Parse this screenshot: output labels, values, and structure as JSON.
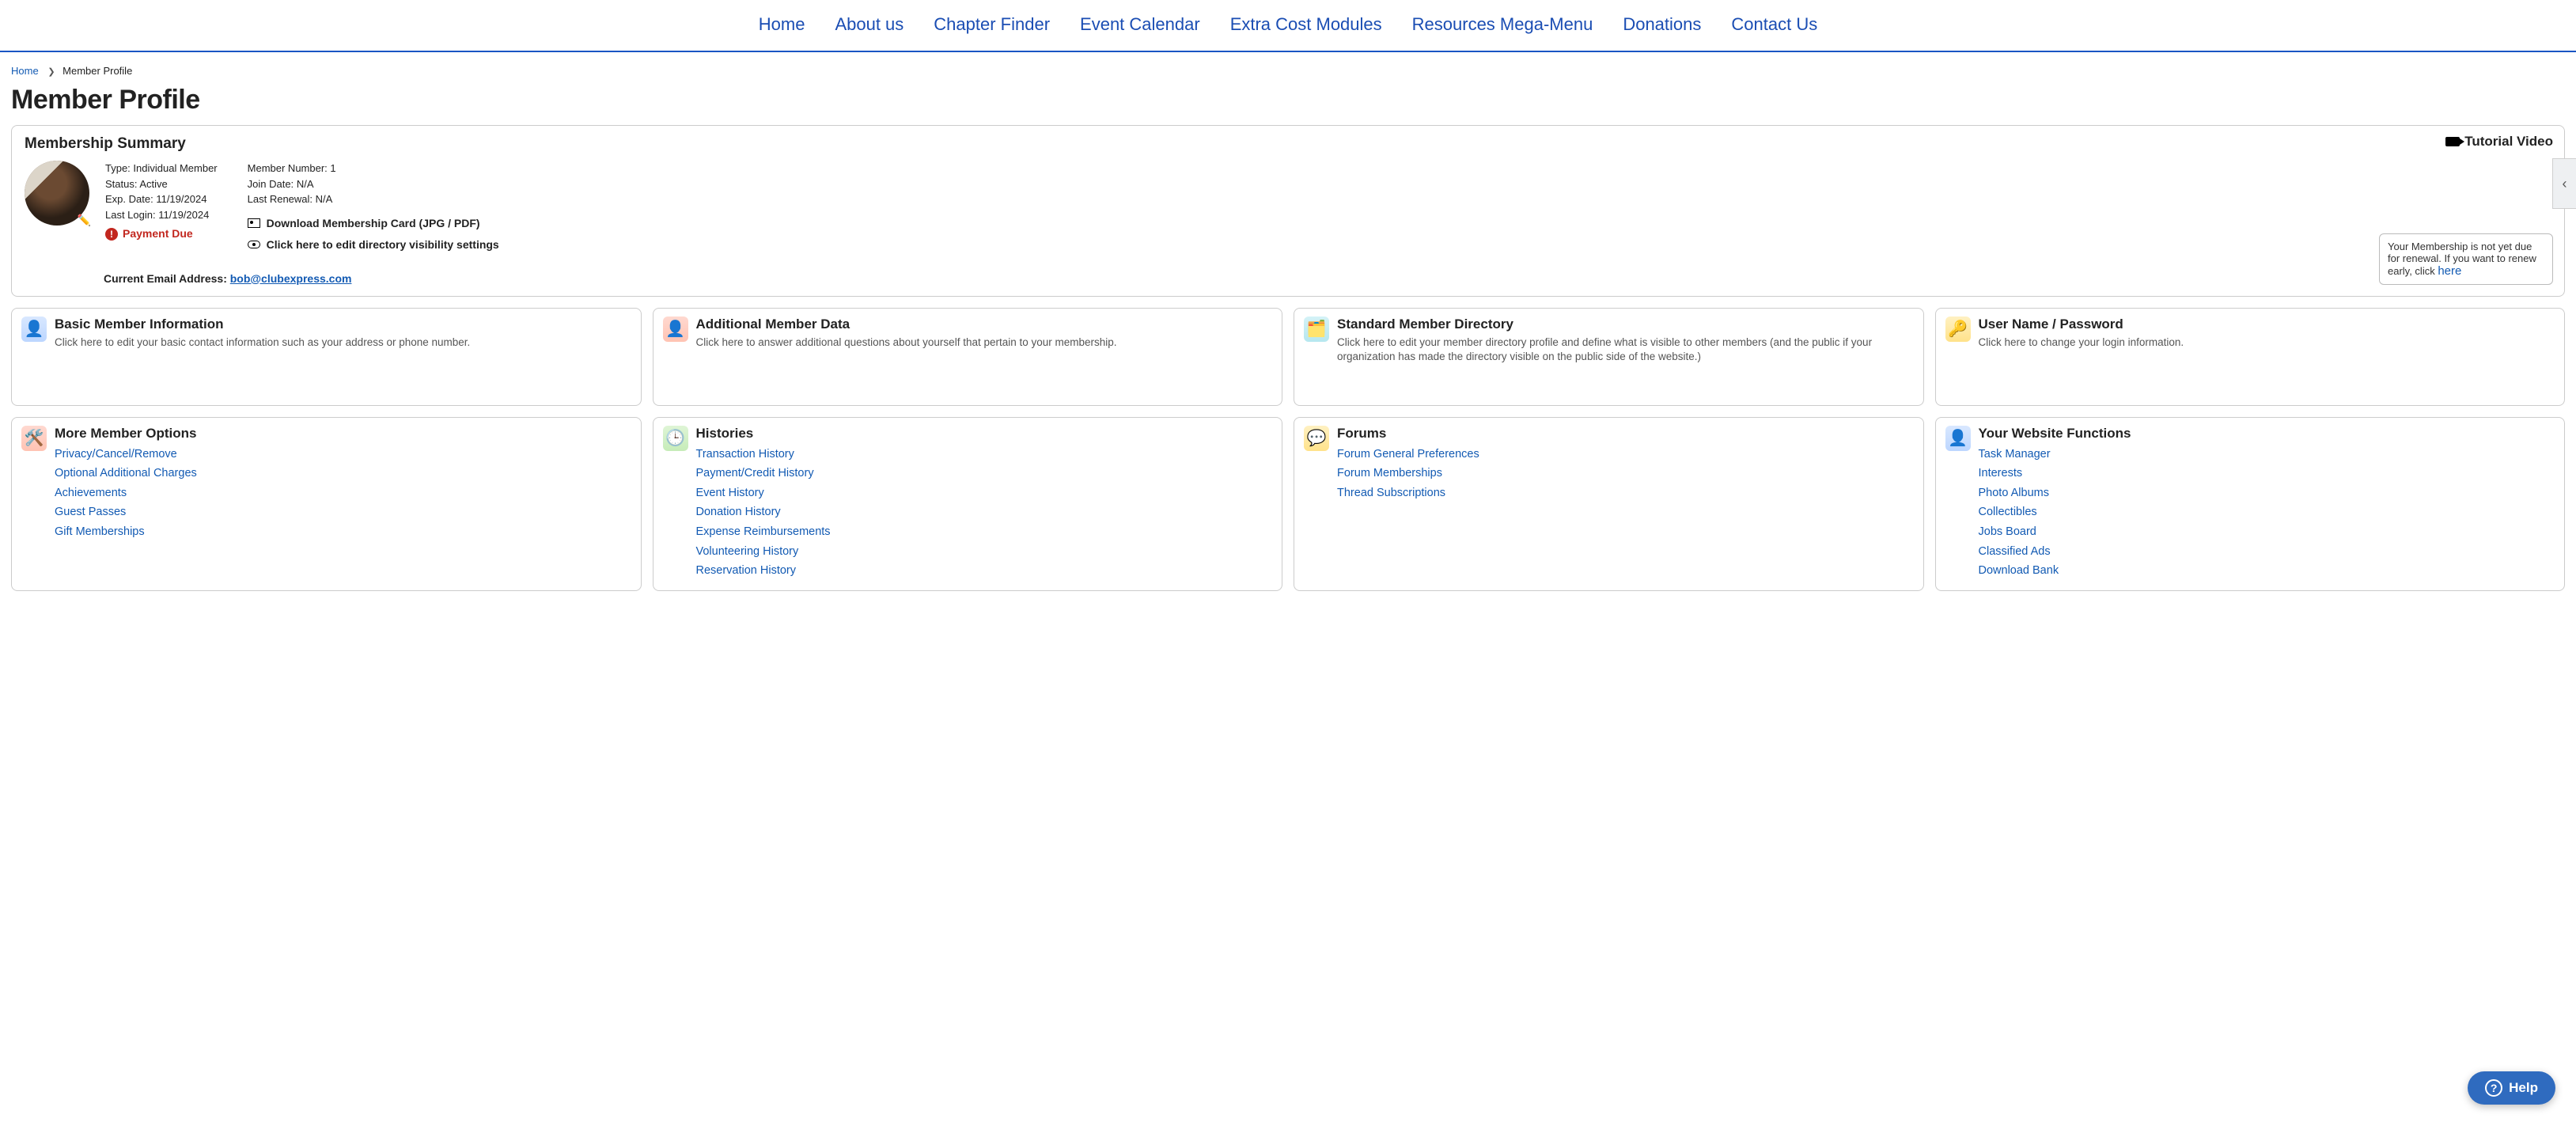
{
  "nav": {
    "items": [
      {
        "label": "Home"
      },
      {
        "label": "About us"
      },
      {
        "label": "Chapter Finder"
      },
      {
        "label": "Event Calendar"
      },
      {
        "label": "Extra Cost Modules"
      },
      {
        "label": "Resources Mega-Menu"
      },
      {
        "label": "Donations"
      },
      {
        "label": "Contact Us"
      }
    ]
  },
  "breadcrumb": {
    "home": "Home",
    "current": "Member Profile"
  },
  "page_title": "Member Profile",
  "summary": {
    "heading": "Membership Summary",
    "tutorial_label": "Tutorial Video",
    "col1": {
      "type_label": "Type:",
      "type_value": "Individual Member",
      "status_label": "Status:",
      "status_value": "Active",
      "exp_label": "Exp. Date:",
      "exp_value": "11/19/2024",
      "lastlogin_label": "Last Login:",
      "lastlogin_value": "11/19/2024",
      "payment_due": "Payment Due"
    },
    "col2": {
      "memno_label": "Member Number:",
      "memno_value": "1",
      "joindate_label": "Join Date:",
      "joindate_value": "N/A",
      "lastrenew_label": "Last Renewal:",
      "lastrenew_value": "N/A",
      "download_card": "Download Membership Card (JPG / PDF)",
      "visibility": "Click here to edit directory visibility settings"
    },
    "email_label": "Current Email Address:",
    "email_value": "bob@clubexpress.com",
    "renew_msg": "Your Membership is not yet due for renewal. If you want to renew early, click ",
    "renew_link": "here"
  },
  "cards_row1": [
    {
      "icon": "person-card-icon",
      "title": "Basic Member Information",
      "desc": "Click here to edit your basic contact information such as your address or phone number."
    },
    {
      "icon": "person-plus-icon",
      "title": "Additional Member Data",
      "desc": "Click here to answer additional questions about yourself that pertain to your membership."
    },
    {
      "icon": "directory-icon",
      "title": "Standard Member Directory",
      "desc": "Click here to edit your member directory profile and define what is visible to other members (and the public if your organization has made the directory visible on the public side of the website.)"
    },
    {
      "icon": "key-icon",
      "title": "User Name / Password",
      "desc": "Click here to change your login information."
    }
  ],
  "cards_row2": [
    {
      "icon": "gear-card-icon",
      "title": "More Member Options",
      "links": [
        "Privacy/Cancel/Remove",
        "Optional Additional Charges",
        "Achievements",
        "Guest Passes",
        "Gift Memberships"
      ]
    },
    {
      "icon": "clock-history-icon",
      "title": "Histories",
      "links": [
        "Transaction History",
        "Payment/Credit History",
        "Event History",
        "Donation History",
        "Expense Reimbursements",
        "Volunteering History",
        "Reservation History"
      ]
    },
    {
      "icon": "chat-bubbles-icon",
      "title": "Forums",
      "links": [
        "Forum General Preferences",
        "Forum Memberships",
        "Thread Subscriptions"
      ]
    },
    {
      "icon": "person-gear-icon",
      "title": "Your Website Functions",
      "links": [
        "Task Manager",
        "Interests",
        "Photo Albums",
        "Collectibles",
        "Jobs Board",
        "Classified Ads",
        "Download Bank"
      ]
    }
  ],
  "help_label": "Help",
  "drawer_glyph": "‹"
}
